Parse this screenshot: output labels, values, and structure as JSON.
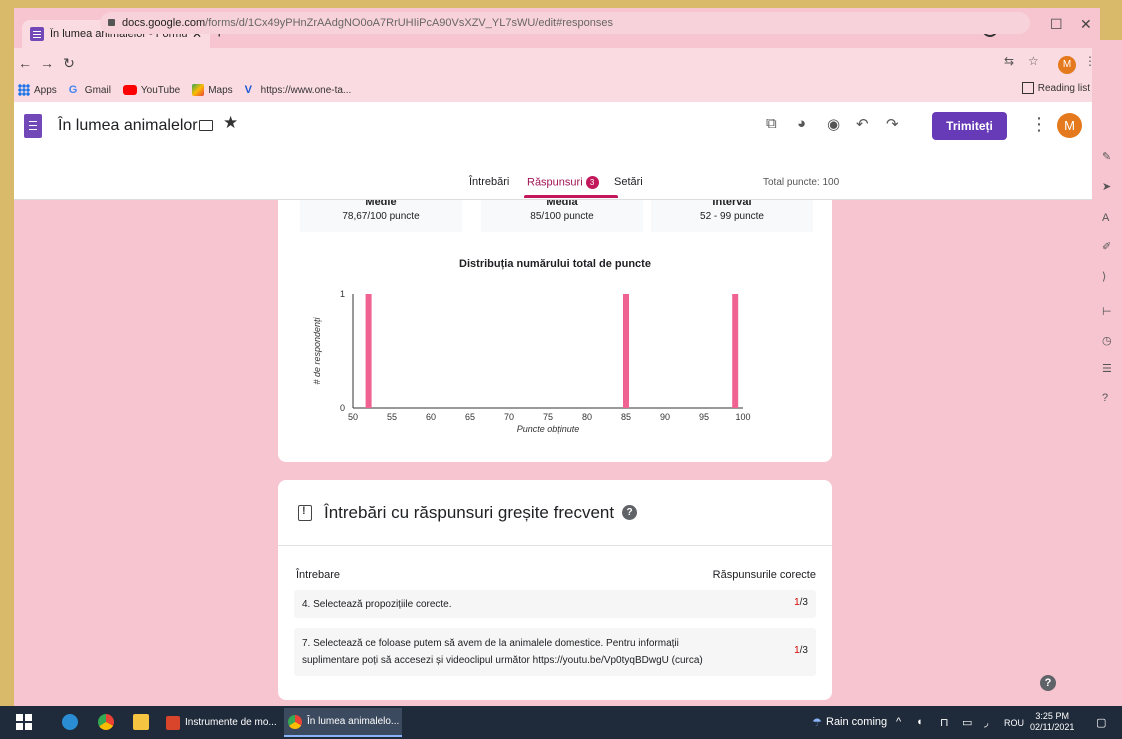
{
  "browser": {
    "tab_title": "În lumea animalelor - Formulare",
    "url_host": "docs.google.com",
    "url_path": "/forms/d/1Cx49yPHnZrAAdgNO0oA7RrUHIiPcA90VsXZV_YL7sWU/edit#responses",
    "avatar_letter": "M",
    "bookmarks": [
      "Apps",
      "Gmail",
      "YouTube",
      "Maps",
      "https://www.one-ta..."
    ],
    "reading_list": "Reading list"
  },
  "header": {
    "form_title": "În lumea animalelor",
    "send_label": "Trimiteți",
    "avatar_letter": "M"
  },
  "tabs": {
    "questions": "Întrebări",
    "responses": "Răspunsuri",
    "responses_count": "3",
    "settings": "Setări",
    "total_points": "Total puncte: 100"
  },
  "stats": [
    {
      "label": "Medie",
      "value": "78,67/100 puncte"
    },
    {
      "label": "Media",
      "value": "85/100 puncte"
    },
    {
      "label": "Interval",
      "value": "52 - 99 puncte"
    }
  ],
  "chart_data": {
    "type": "bar",
    "title": "Distribuția numărului total de puncte",
    "xlabel": "Puncte obținute",
    "ylabel": "# de respondenți",
    "xlim": [
      50,
      100
    ],
    "ylim": [
      0,
      1
    ],
    "xticks": [
      "50",
      "55",
      "60",
      "65",
      "70",
      "75",
      "80",
      "85",
      "90",
      "95",
      "100"
    ],
    "yticks": [
      "0",
      "1"
    ],
    "x": [
      52,
      85,
      99
    ],
    "values": [
      1,
      1,
      1
    ],
    "color": "#f06292"
  },
  "wrong": {
    "title": "Întrebări cu răspunsuri greșite frecvent",
    "col_question": "Întrebare",
    "col_correct": "Răspunsurile corecte",
    "rows": [
      {
        "line1": "4. Selectează propozițiile corecte.",
        "line2": "",
        "num": "1",
        "den": "/3"
      },
      {
        "line1": "7. Selectează ce foloase putem să avem de la animalele domestice. Pentru informații",
        "line2": "suplimentare poți să accesezi și videoclipul următor https://youtu.be/Vp0tyqBDwgU (curca)",
        "num": "1",
        "den": "/3"
      }
    ]
  },
  "taskbar": {
    "app1": "Instrumente de mo...",
    "app2": "În lumea animalelo...",
    "weather": "Rain coming",
    "lang": "ROU",
    "time": "3:25 PM",
    "date": "02/11/2021"
  },
  "colors": {
    "accent": "#673ab7",
    "responses_accent": "#c2185b",
    "page_bg": "#f6c5d0",
    "bar": "#f06292"
  }
}
